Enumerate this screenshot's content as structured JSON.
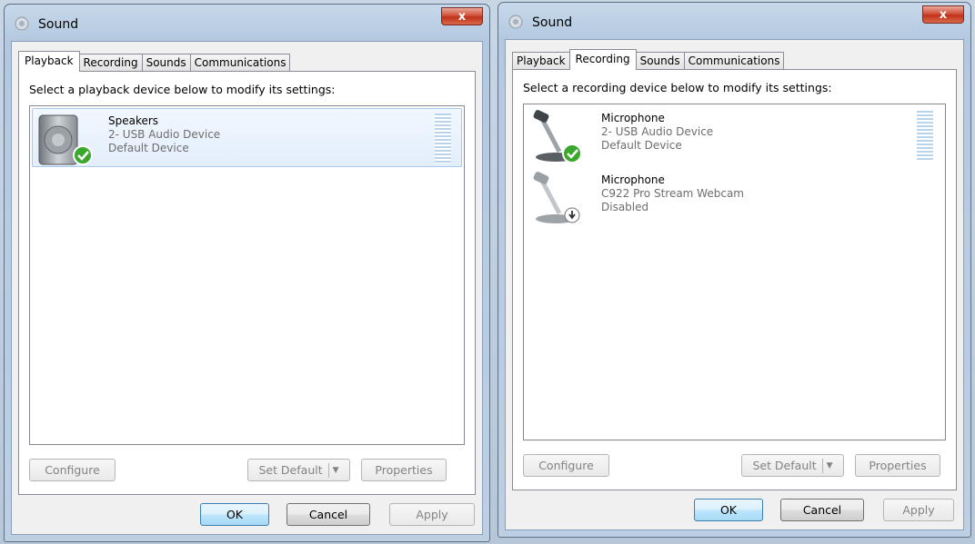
{
  "left_window": {
    "title": "Sound",
    "close_label": "x",
    "tabs": [
      "Playback",
      "Recording",
      "Sounds",
      "Communications"
    ],
    "active_tab": "Playback",
    "instruction": "Select a playback device below to modify its settings:",
    "devices": [
      {
        "name": "Speakers",
        "line2": "2- USB Audio Device",
        "line3": "Default Device",
        "icon": "speaker-icon",
        "status": "default-check"
      }
    ],
    "buttons": {
      "configure": "Configure",
      "set_default": "Set Default",
      "properties": "Properties"
    },
    "footer": {
      "ok": "OK",
      "cancel": "Cancel",
      "apply": "Apply"
    }
  },
  "right_window": {
    "title": "Sound",
    "close_label": "x",
    "tabs": [
      "Playback",
      "Recording",
      "Sounds",
      "Communications"
    ],
    "active_tab": "Recording",
    "instruction": "Select a recording device below to modify its settings:",
    "devices": [
      {
        "name": "Microphone",
        "line2": "2- USB Audio Device",
        "line3": "Default Device",
        "icon": "microphone-icon",
        "status": "default-check"
      },
      {
        "name": "Microphone",
        "line2": "C922 Pro Stream Webcam",
        "line3": "Disabled",
        "icon": "microphone-icon",
        "status": "disabled-arrow"
      }
    ],
    "buttons": {
      "configure": "Configure",
      "set_default": "Set Default",
      "properties": "Properties"
    },
    "footer": {
      "ok": "OK",
      "cancel": "Cancel",
      "apply": "Apply"
    }
  },
  "colors": {
    "check_green": "#3aa82c",
    "selection_border": "#a9c8ed",
    "close_red": "#c1321b"
  }
}
